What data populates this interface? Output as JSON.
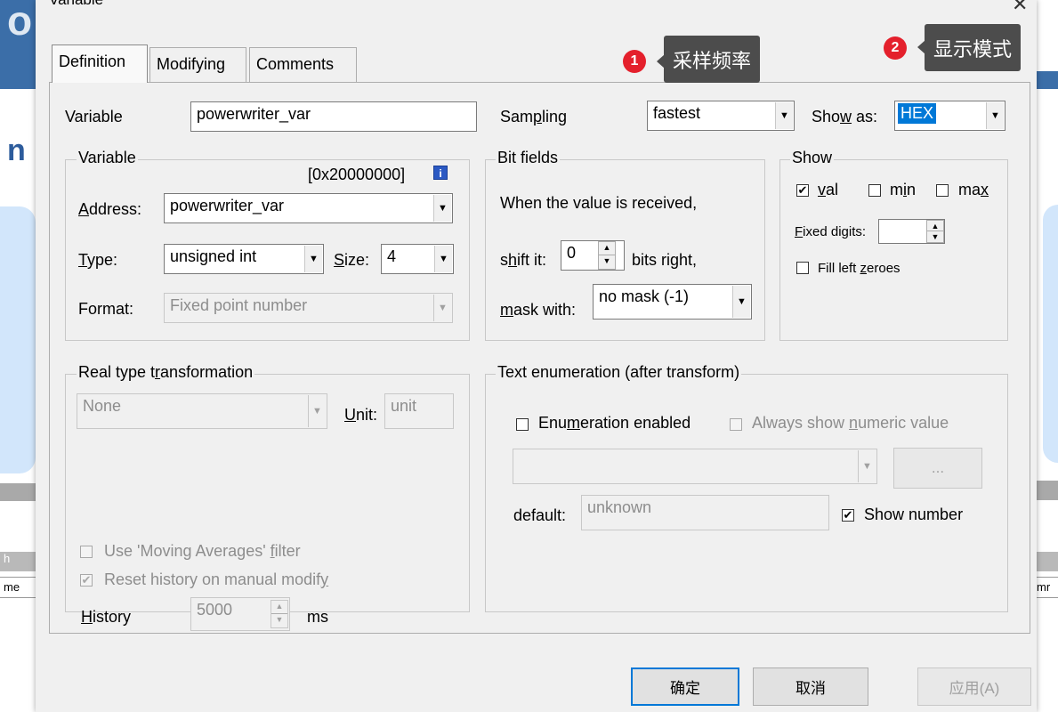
{
  "dialog": {
    "title": "Variable",
    "close_glyph": "✕"
  },
  "background": {
    "left_letter": "o",
    "left_letter2": "n",
    "left_bar_text": "h",
    "left_row_text": "me",
    "right_row_text": "mr"
  },
  "tabs": [
    {
      "label": "Definition",
      "active": true
    },
    {
      "label": "Modifying",
      "active": false
    },
    {
      "label": "Comments",
      "active": false
    }
  ],
  "variable_field": {
    "label": "Variable",
    "value": "powerwriter_var"
  },
  "sampling": {
    "label_pre": "Sam",
    "label_u": "p",
    "label_post": "ling",
    "value": "fastest"
  },
  "show_as": {
    "label_pre": "Sho",
    "label_u": "w",
    "label_post": " as:",
    "value": "HEX"
  },
  "variable_group": {
    "title": "Variable",
    "address_hex": "[0x20000000]",
    "info_icon": "i",
    "address": {
      "label_u": "A",
      "label_post": "ddress:",
      "value": "powerwriter_var"
    },
    "type": {
      "label_u": "T",
      "label_post": "ype:",
      "value": "unsigned int"
    },
    "size": {
      "label_u": "S",
      "label_post": "ize:",
      "value": "4"
    },
    "format": {
      "label": "Format:",
      "value": "Fixed point number"
    }
  },
  "bit_fields": {
    "title": "Bit fields",
    "desc": "When the value is received,",
    "shift_label_pre": "s",
    "shift_label_u": "h",
    "shift_label_post": "ift it:",
    "shift_value": "0",
    "bits_right": "bits right,",
    "mask_label_u": "m",
    "mask_label_post": "ask with:",
    "mask_value": "no mask (-1)"
  },
  "show_group": {
    "title": "Show",
    "val": {
      "label_u": "v",
      "label_post": "al",
      "checked": "✔"
    },
    "min": {
      "label_pre": "m",
      "label_u": "i",
      "label_post": "n"
    },
    "max": {
      "label_pre": "ma",
      "label_u": "x"
    },
    "fixed_digits": {
      "label_u": "F",
      "label_post": "ixed digits:"
    },
    "fill_left_zeroes": {
      "label_pre": "Fill left ",
      "label_u": "z",
      "label_post": "eroes"
    }
  },
  "real_type": {
    "title_pre": "Real type t",
    "title_u": "r",
    "title_post": "ansformation",
    "value": "None",
    "unit_label_u": "U",
    "unit_label_post": "nit:",
    "unit_value": "unit",
    "moving_avg": {
      "label_pre": "Use 'Moving Averages' ",
      "label_u": "f",
      "label_post": "ilter"
    },
    "reset_history": {
      "label_pre": "Reset history on manual modif",
      "label_u": "y",
      "checked": "✔"
    },
    "history_label_u": "H",
    "history_label_post": "istory",
    "history_value": "5000",
    "history_unit": "ms"
  },
  "text_enum": {
    "title": "Text enumeration (after transform)",
    "enabled": {
      "label_pre": "Enu",
      "label_u": "m",
      "label_post": "eration enabled"
    },
    "always_numeric": {
      "label_pre": "Always show ",
      "label_u": "n",
      "label_post": "umeric value"
    },
    "ellipsis_button": "...",
    "default_label": "default:",
    "default_value": "unknown",
    "show_number": {
      "label": "Show number",
      "checked": "✔"
    }
  },
  "buttons": {
    "ok": "确定",
    "cancel": "取消",
    "apply": "应用(A)"
  },
  "callouts": [
    {
      "number": "1",
      "text": "采样频率"
    },
    {
      "number": "2",
      "text": "显示模式"
    }
  ],
  "colors": {
    "badge": "#e4202c",
    "callout_bg": "#4c4c4c",
    "highlight": "#0078d7"
  }
}
